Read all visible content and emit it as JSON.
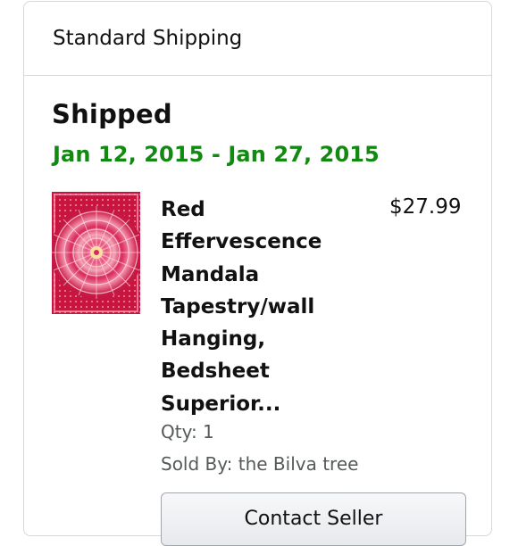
{
  "header": {
    "title": "Standard Shipping"
  },
  "shipment": {
    "status": "Shipped",
    "delivery_range": "Jan 12, 2015 - Jan 27, 2015",
    "status_color": "#128a12"
  },
  "item": {
    "title": "Red\nEffervescence\nMandala\nTapestry/wall\nHanging,\nBedsheet\nSuperior...",
    "price": "$27.99",
    "quantity": "Qty: 1",
    "sold_by": "Sold By: the Bilva tree",
    "image_icon": "mandala-tapestry-image"
  },
  "actions": {
    "contact_seller_label": "Contact Seller"
  }
}
